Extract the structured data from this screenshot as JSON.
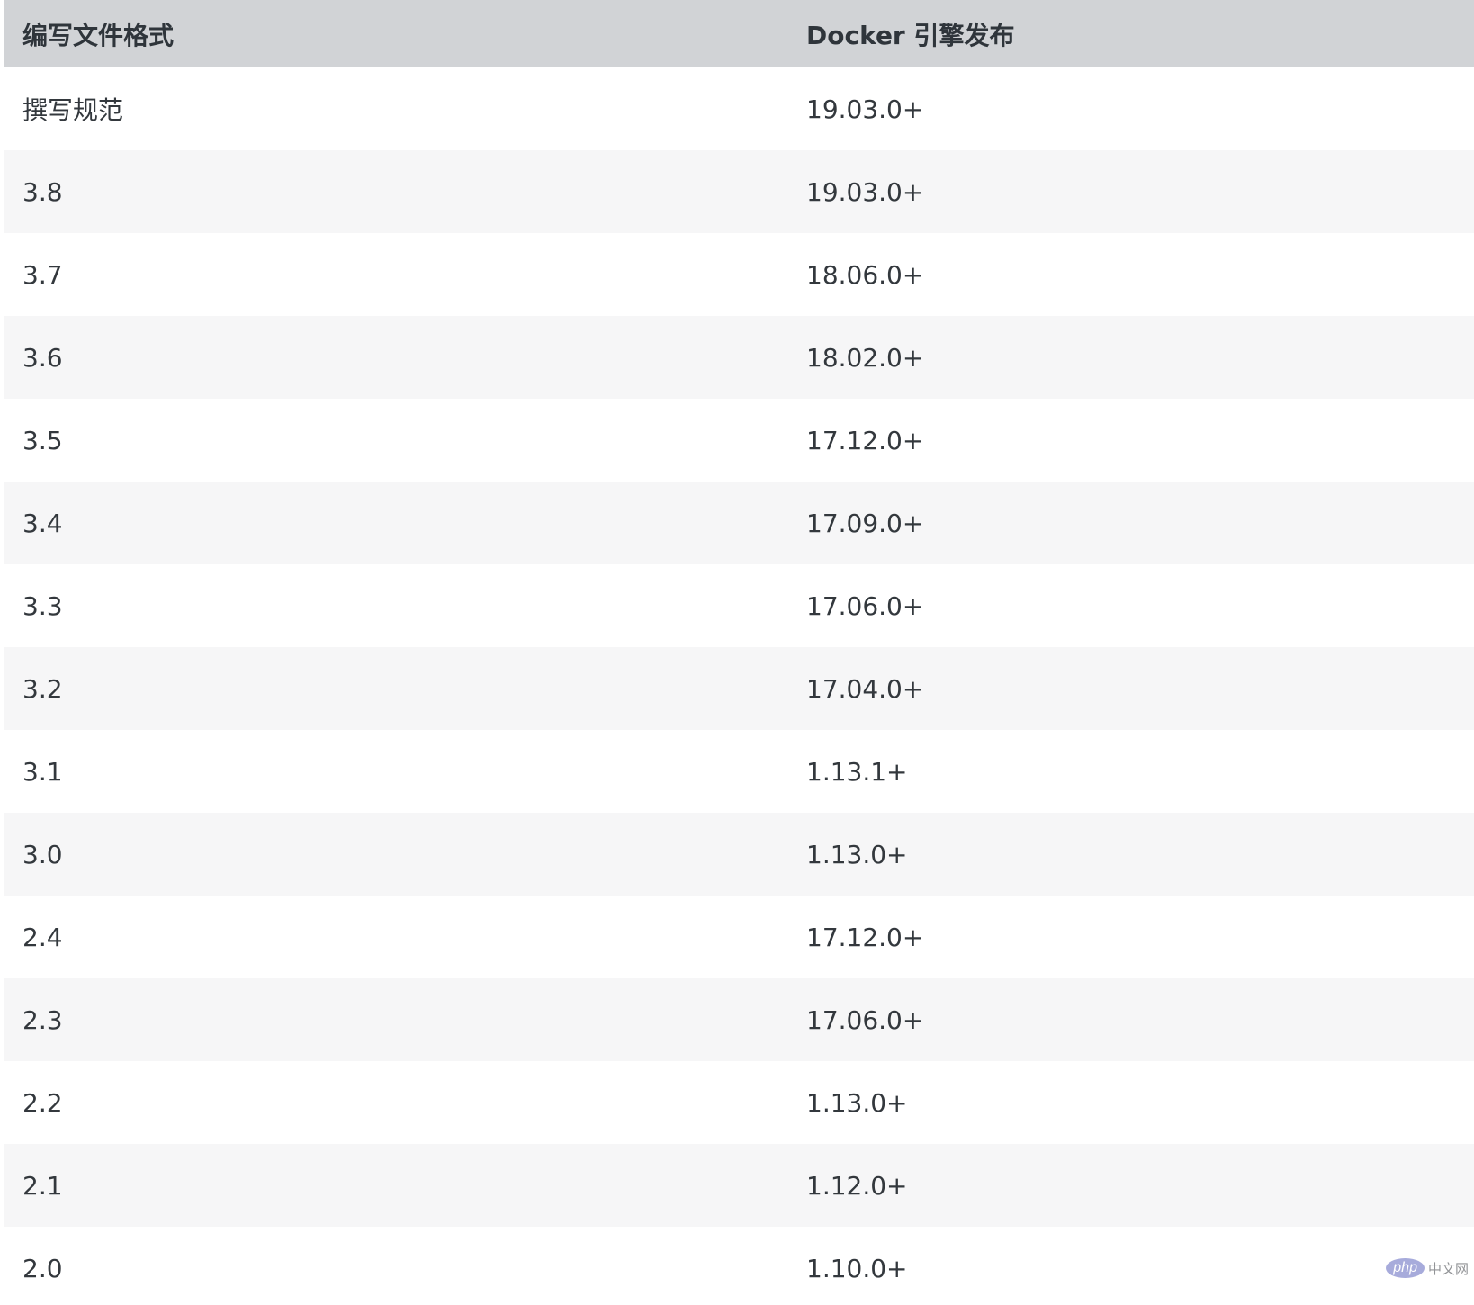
{
  "table": {
    "headers": [
      "编写文件格式",
      "Docker 引擎发布"
    ],
    "rows": [
      [
        "撰写规范",
        "19.03.0+"
      ],
      [
        "3.8",
        "19.03.0+"
      ],
      [
        "3.7",
        "18.06.0+"
      ],
      [
        "3.6",
        "18.02.0+"
      ],
      [
        "3.5",
        "17.12.0+"
      ],
      [
        "3.4",
        "17.09.0+"
      ],
      [
        "3.3",
        "17.06.0+"
      ],
      [
        "3.2",
        "17.04.0+"
      ],
      [
        "3.1",
        "1.13.1+"
      ],
      [
        "3.0",
        "1.13.0+"
      ],
      [
        "2.4",
        "17.12.0+"
      ],
      [
        "2.3",
        "17.06.0+"
      ],
      [
        "2.2",
        "1.13.0+"
      ],
      [
        "2.1",
        "1.12.0+"
      ],
      [
        "2.0",
        "1.10.0+"
      ]
    ]
  },
  "watermark": {
    "badge": "php",
    "text": "中文网"
  }
}
